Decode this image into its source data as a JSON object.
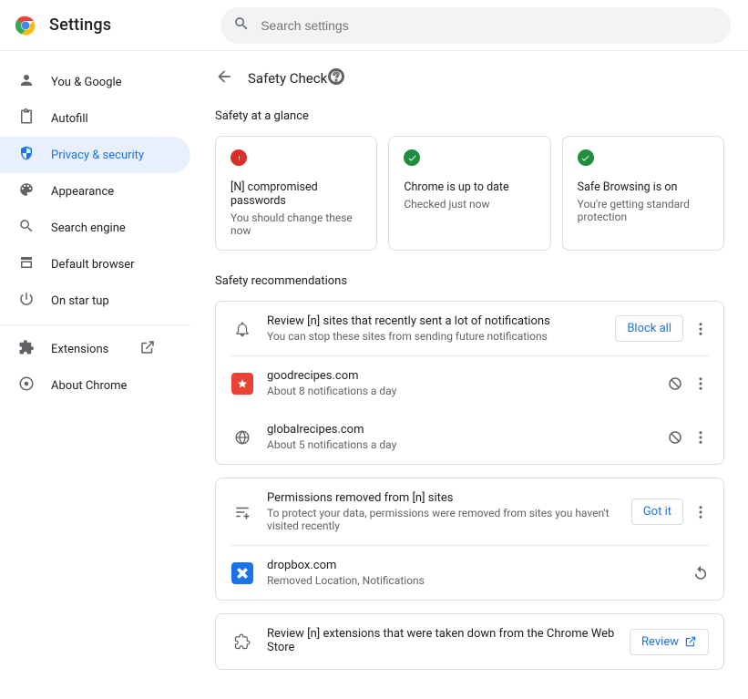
{
  "header": {
    "title": "Settings",
    "search_placeholder": "Search settings"
  },
  "sidebar": {
    "items": [
      {
        "id": "you",
        "label": "You & Google"
      },
      {
        "id": "autofill",
        "label": "Autofill"
      },
      {
        "id": "privacy",
        "label": "Privacy & security",
        "active": true
      },
      {
        "id": "appearance",
        "label": "Appearance"
      },
      {
        "id": "search",
        "label": "Search engine"
      },
      {
        "id": "default",
        "label": "Default browser"
      },
      {
        "id": "startup",
        "label": "On star  tup"
      }
    ],
    "footer": [
      {
        "id": "ext",
        "label": "Extensions",
        "external": true
      },
      {
        "id": "about",
        "label": "About Chrome"
      }
    ]
  },
  "page": {
    "title": "Safety Check",
    "glance_label": "Safety at a glance",
    "recs_label": "Safety recommendations",
    "cards": [
      {
        "status": "red",
        "title": "[N] compromised passwords",
        "sub": "You should change these now"
      },
      {
        "status": "green",
        "title": "Chrome is up to date",
        "sub": "Checked just now"
      },
      {
        "status": "green",
        "title": "Safe Browsing is on",
        "sub": "You're getting standard protection"
      }
    ],
    "notifications": {
      "title": "Review [n] sites that recently sent a lot of notifications",
      "sub": "You can stop these sites from sending future notifications",
      "block_all": "Block all",
      "sites": [
        {
          "icon": "red",
          "host": "goodrecipes.com",
          "sub": "About 8 notifications a day"
        },
        {
          "icon": "gray",
          "host": "globalrecipes.com",
          "sub": "About 5 notifications a day"
        }
      ]
    },
    "permissions": {
      "title": "Permissions removed from [n] sites",
      "sub": "To protect your data, permissions were removed from sites you haven't visited recently",
      "got_it": "Got it",
      "sites": [
        {
          "icon": "blue",
          "host": "dropbox.com",
          "sub": "Removed Location, Notifications"
        }
      ]
    },
    "ext": {
      "title": "Review [n] extensions that were taken down from the Chrome Web Store",
      "review": "Review"
    }
  }
}
